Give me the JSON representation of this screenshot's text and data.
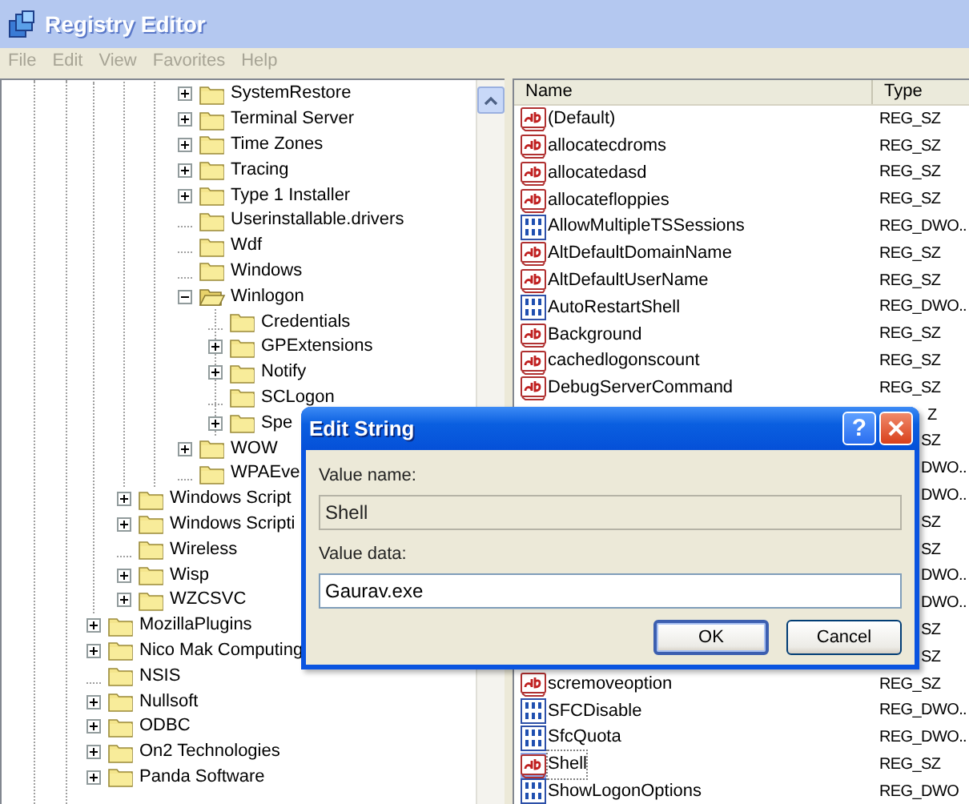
{
  "window": {
    "title": "Registry Editor"
  },
  "menu": [
    "File",
    "Edit",
    "View",
    "Favorites",
    "Help"
  ],
  "tree": {
    "items": [
      {
        "children": [
          {
            "children": [
              {
                "children": [
                  {
                    "label": "SystemRestore",
                    "expandable": true,
                    "expanded": false
                  },
                  {
                    "label": "Terminal Server",
                    "expandable": true,
                    "expanded": false
                  },
                  {
                    "label": "Time Zones",
                    "expandable": true,
                    "expanded": false
                  },
                  {
                    "label": "Tracing",
                    "expandable": true,
                    "expanded": false
                  },
                  {
                    "label": "Type 1 Installer",
                    "expandable": true,
                    "expanded": false
                  },
                  {
                    "label": "Userinstallable.drivers",
                    "expandable": false
                  },
                  {
                    "label": "Wdf",
                    "expandable": false
                  },
                  {
                    "label": "Windows",
                    "expandable": false
                  },
                  {
                    "label": "Winlogon",
                    "expandable": true,
                    "expanded": true,
                    "children": [
                      {
                        "label": "Credentials",
                        "expandable": false
                      },
                      {
                        "label": "GPExtensions",
                        "expandable": true,
                        "expanded": false
                      },
                      {
                        "label": "Notify",
                        "expandable": true,
                        "expanded": false
                      },
                      {
                        "label": "SCLogon",
                        "expandable": false
                      },
                      {
                        "label": "Spe",
                        "expandable": true,
                        "expanded": false
                      }
                    ]
                  },
                  {
                    "label": "WOW",
                    "expandable": true,
                    "expanded": false
                  },
                  {
                    "label": "WPAEve",
                    "expandable": false
                  }
                ]
              }
            ]
          },
          {
            "label": "Windows Script",
            "expandable": true,
            "expanded": false
          },
          {
            "label": "Windows Scripti",
            "expandable": true,
            "expanded": false
          },
          {
            "label": "Wireless",
            "expandable": false
          },
          {
            "label": "Wisp",
            "expandable": true,
            "expanded": false
          },
          {
            "label": "WZCSVC",
            "expandable": true,
            "expanded": false
          }
        ]
      },
      {
        "label": "MozillaPlugins",
        "expandable": true,
        "expanded": false
      },
      {
        "label": "Nico Mak Computing",
        "expandable": true,
        "expanded": false
      },
      {
        "label": "NSIS",
        "expandable": false
      },
      {
        "label": "Nullsoft",
        "expandable": true,
        "expanded": false
      },
      {
        "label": "ODBC",
        "expandable": true,
        "expanded": false
      },
      {
        "label": "On2 Technologies",
        "expandable": true,
        "expanded": false
      },
      {
        "label": "Panda Software",
        "expandable": true,
        "expanded": false
      }
    ]
  },
  "values": {
    "columns": [
      "Name",
      "Type"
    ],
    "rows": [
      {
        "kind": "string",
        "name": "(Default)",
        "type": "REG_SZ",
        "selected": false
      },
      {
        "kind": "string",
        "name": "allocatecdroms",
        "type": "REG_SZ",
        "selected": false
      },
      {
        "kind": "string",
        "name": "allocatedasd",
        "type": "REG_SZ",
        "selected": false
      },
      {
        "kind": "string",
        "name": "allocatefloppies",
        "type": "REG_SZ",
        "selected": false
      },
      {
        "kind": "dword",
        "name": "AllowMultipleTSSessions",
        "type": "REG_DWO..",
        "selected": false
      },
      {
        "kind": "string",
        "name": "AltDefaultDomainName",
        "type": "REG_SZ",
        "selected": false
      },
      {
        "kind": "string",
        "name": "AltDefaultUserName",
        "type": "REG_SZ",
        "selected": false
      },
      {
        "kind": "dword",
        "name": "AutoRestartShell",
        "type": "REG_DWO..",
        "selected": false
      },
      {
        "kind": "string",
        "name": "Background",
        "type": "REG_SZ",
        "selected": false
      },
      {
        "kind": "string",
        "name": "cachedlogonscount",
        "type": "REG_SZ",
        "selected": false
      },
      {
        "kind": "string",
        "name": "DebugServerCommand",
        "type": "REG_SZ",
        "selected": false
      },
      {
        "type": "Z"
      },
      {
        "type": "SZ"
      },
      {
        "type": "DWO.."
      },
      {
        "type": "DWO.."
      },
      {
        "type": "SZ"
      },
      {
        "type": "SZ"
      },
      {
        "type": "DWO.."
      },
      {
        "type": "DWO.."
      },
      {
        "type": "SZ"
      },
      {
        "type": "SZ"
      },
      {
        "kind": "string",
        "name": "scremoveoption",
        "type": "REG_SZ",
        "selected": false
      },
      {
        "kind": "dword",
        "name": "SFCDisable",
        "type": "REG_DWO..",
        "selected": false
      },
      {
        "kind": "dword",
        "name": "SfcQuota",
        "type": "REG_DWO..",
        "selected": false
      },
      {
        "kind": "string",
        "name": "Shell",
        "type": "REG_SZ",
        "selected": true
      },
      {
        "kind": "dword",
        "name": "ShowLogonOptions",
        "type": "REG_DWO",
        "selected": false
      }
    ]
  },
  "dialog": {
    "title": "Edit String",
    "help_button": "?",
    "fields": [
      {
        "label": "Value name:",
        "value": "Shell",
        "disabled": true
      },
      {
        "label": "Value data:",
        "value": "Gaurav.exe",
        "disabled": false
      }
    ],
    "buttons": [
      {
        "label": "OK",
        "default": true
      },
      {
        "label": "Cancel",
        "default": false
      }
    ]
  }
}
